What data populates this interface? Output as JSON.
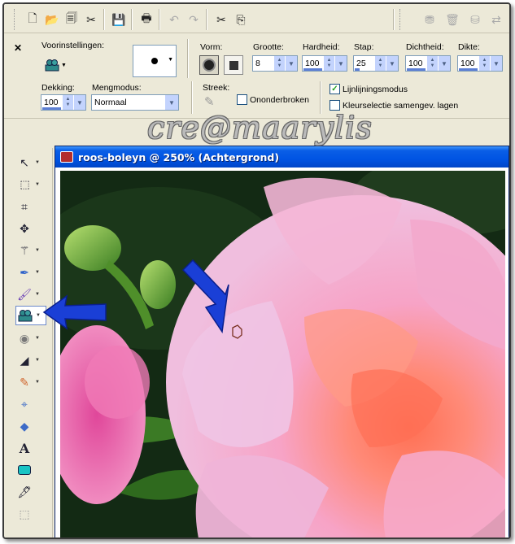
{
  "watermark": "cre@maarylis",
  "toolbar": {
    "icons": [
      "new-icon",
      "open-icon",
      "save-copy-icon",
      "browse-icon",
      "save-icon",
      "print-icon",
      "undo-icon",
      "redo-icon",
      "cut-icon",
      "copy-icon",
      "layer-icon",
      "delete-icon",
      "palette-icon"
    ]
  },
  "options": {
    "presets_label": "Voorinstellingen:",
    "shape_label": "Vorm:",
    "size_label": "Grootte:",
    "size_value": "8",
    "hardness_label": "Hardheid:",
    "hardness_value": "100",
    "step_label": "Stap:",
    "step_value": "25",
    "density_label": "Dichtheid:",
    "density_value": "100",
    "thickness_label": "Dikte:",
    "thickness_value": "100",
    "opacity_label": "Dekking:",
    "opacity_value": "100",
    "blend_label": "Mengmodus:",
    "blend_value": "Normaal",
    "stroke_label": "Streek:",
    "continuous_label": "Ononderbroken",
    "continuous_checked": false,
    "line_mode_label": "Lijnlijningsmodus",
    "line_mode_checked": true,
    "color_select_label": "Kleurselectie samengev. lagen",
    "color_select_checked": false
  },
  "tools": [
    "pointer-tool",
    "selection-tool",
    "crop-tool",
    "move-tool",
    "magic-wand-tool",
    "dropper-tool",
    "paint-brush-tool",
    "clone-brush-tool",
    "dodge-tool",
    "background-eraser-tool",
    "airbrush-tool",
    "eraser-tool",
    "fill-tool",
    "text-tool",
    "preset-shape-tool",
    "pen-tool",
    "warp-tool"
  ],
  "active_tool": "clone-brush-tool",
  "document": {
    "title": "roos-boleyn @ 250% (Achtergrond)"
  },
  "colors": {
    "title_bar": "#0054e3",
    "arrow": "#1a3fd6",
    "workspace": "#ece9d8"
  }
}
